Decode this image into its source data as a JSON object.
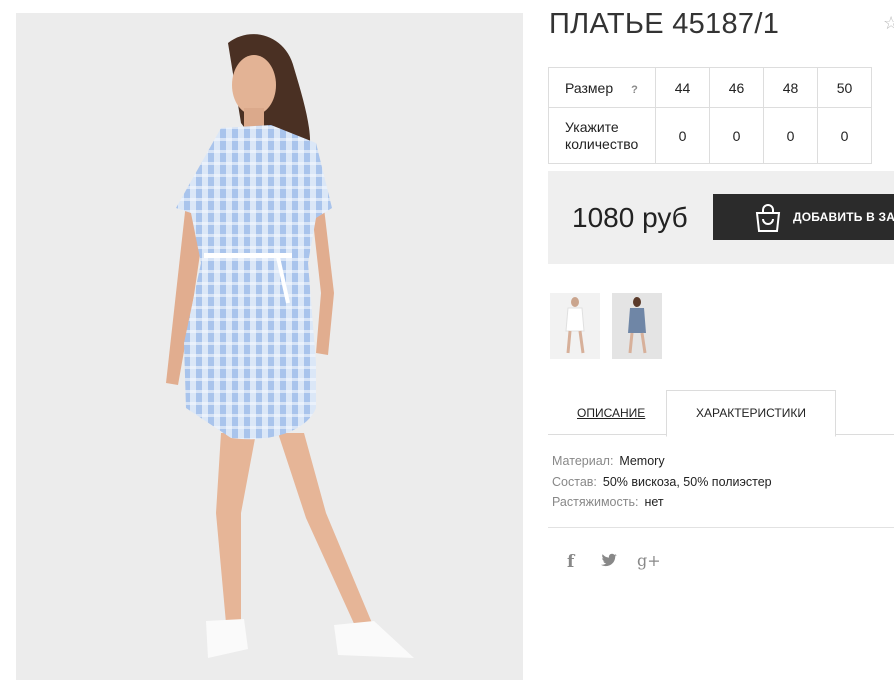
{
  "product": {
    "title": "ПЛАТЬЕ 45187/1",
    "favorite_icon": "star-outline-icon"
  },
  "sizes": {
    "header_label": "Размер",
    "help_mark": "?",
    "size_values": [
      "44",
      "46",
      "48",
      "50"
    ],
    "quantity_label_line1": "Укажите",
    "quantity_label_line2": "количество",
    "quantities": [
      "0",
      "0",
      "0",
      "0"
    ]
  },
  "purchase": {
    "price": "1080 руб",
    "add_button_label": "ДОБАВИТЬ В ЗАКАЗ",
    "add_button_icon": "shopping-bag-icon",
    "button_color": "#2b2b2b",
    "box_color": "#efefef"
  },
  "thumbnails": [
    {
      "name": "white-dress-thumbnail"
    },
    {
      "name": "striped-dress-thumbnail"
    }
  ],
  "tabs": {
    "description": "ОПИСАНИЕ",
    "characteristics": "ХАРАКТЕРИСТИКИ",
    "active": "characteristics"
  },
  "specs": [
    {
      "label": "Материал:",
      "value": "Memory"
    },
    {
      "label": "Состав:",
      "value": "50% вискоза, 50% полиэстер"
    },
    {
      "label": "Растяжимость:",
      "value": "нет"
    }
  ],
  "social": {
    "facebook": "f",
    "twitter_icon": "twitter-bird-icon",
    "googleplus": "g+"
  }
}
